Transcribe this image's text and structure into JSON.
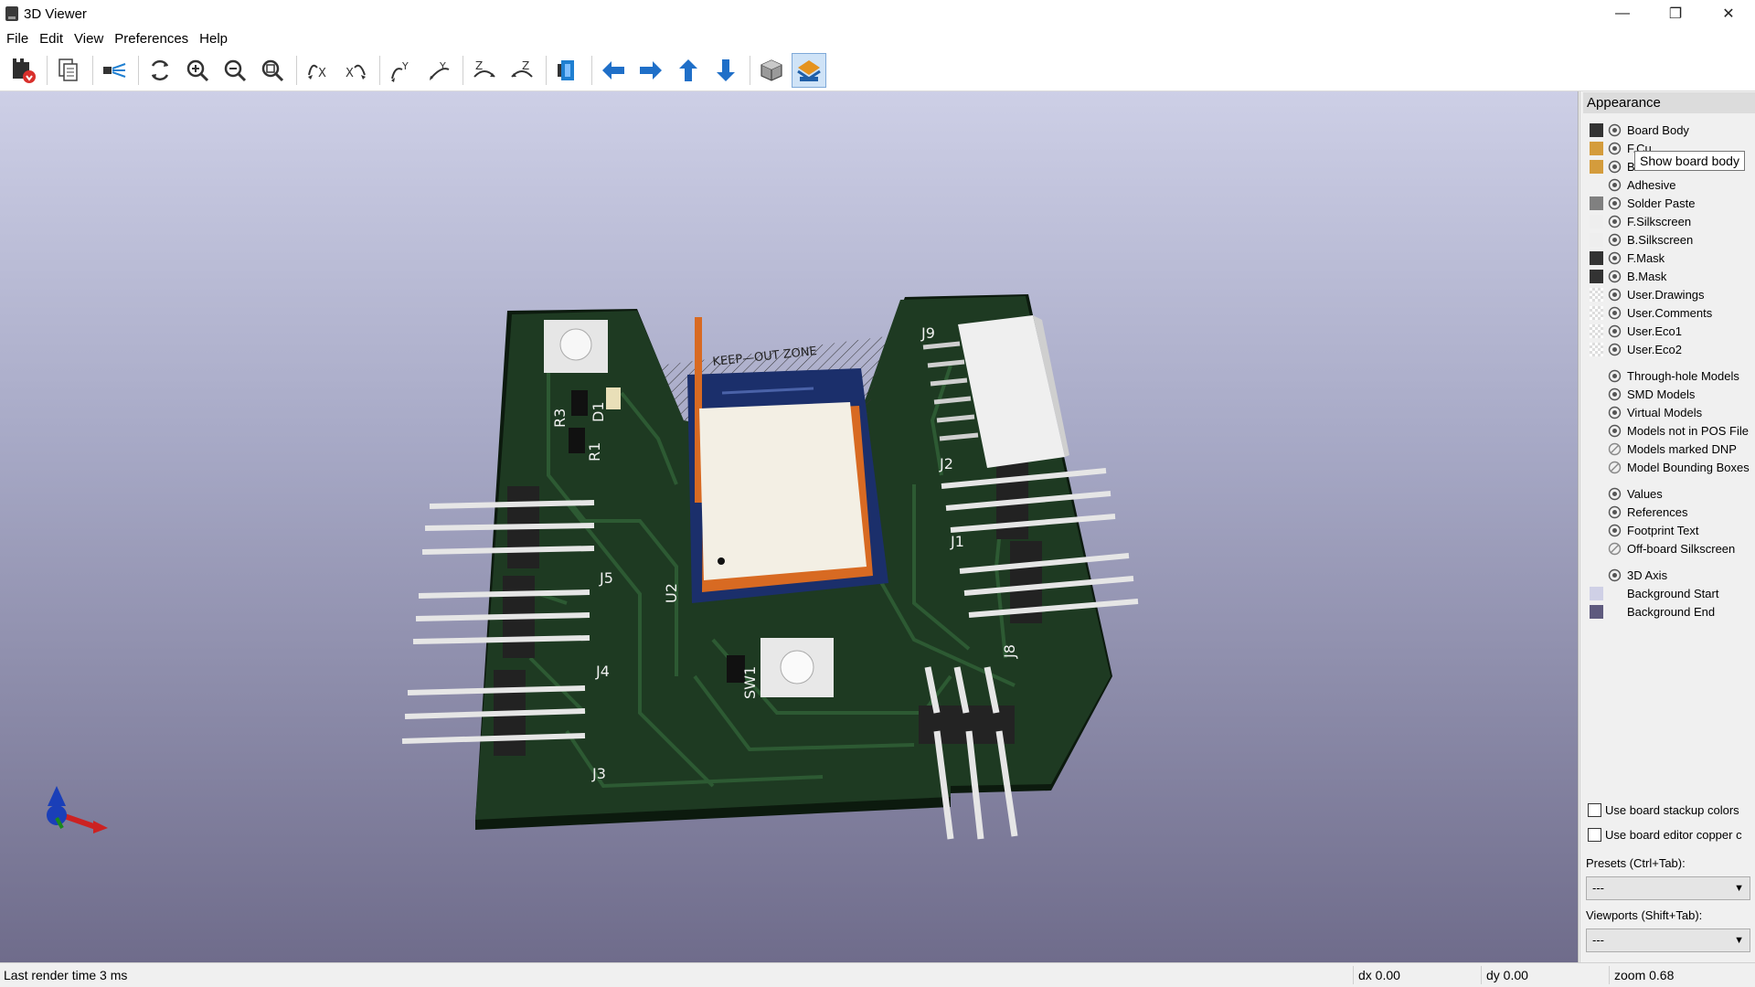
{
  "window": {
    "title": "3D Viewer",
    "controls": {
      "minimize": "—",
      "restore": "❐",
      "close": "✕"
    }
  },
  "menu": [
    "File",
    "Edit",
    "View",
    "Preferences",
    "Help"
  ],
  "toolbar": {
    "buttons": [
      "reload-board-icon",
      "copy-image-icon",
      "raytracing-icon",
      "redraw-icon",
      "zoom-in-icon",
      "zoom-out-icon",
      "zoom-fit-icon",
      "rotate-x-cw-icon",
      "rotate-x-ccw-icon",
      "rotate-y-cw-icon",
      "rotate-y-ccw-icon",
      "rotate-z-cw-icon",
      "rotate-z-ccw-icon",
      "flip-board-icon",
      "pan-left-icon",
      "pan-right-icon",
      "pan-up-icon",
      "pan-down-icon",
      "toggle-ortho-icon",
      "layers-manager-icon"
    ],
    "active": "layers-manager-icon"
  },
  "viewport": {
    "keepout_text": "KEEP—OUT ZONE",
    "refs": [
      "R3",
      "D1",
      "R1",
      "J5",
      "J4",
      "J3",
      "U2",
      "SW1",
      "J9",
      "J2",
      "J1",
      "J8"
    ]
  },
  "appearance": {
    "title": "Appearance",
    "layers": [
      {
        "name": "Board Body",
        "color": "#333333",
        "swatch": true
      },
      {
        "name": "F.Cu",
        "color": "#d49c3c",
        "swatch": true
      },
      {
        "name": "B.Cu",
        "color": "#d49c3c",
        "swatch": true
      },
      {
        "name": "Adhesive",
        "color": "",
        "swatch": false
      },
      {
        "name": "Solder Paste",
        "color": "#808080",
        "swatch": true
      },
      {
        "name": "F.Silkscreen",
        "color": "#eeeeee",
        "swatch": true
      },
      {
        "name": "B.Silkscreen",
        "color": "#eeeeee",
        "swatch": true
      },
      {
        "name": "F.Mask",
        "color": "#333333",
        "swatch": true
      },
      {
        "name": "B.Mask",
        "color": "#333333",
        "swatch": true
      },
      {
        "name": "User.Drawings",
        "color": "checker",
        "swatch": true
      },
      {
        "name": "User.Comments",
        "color": "checker",
        "swatch": true
      },
      {
        "name": "User.Eco1",
        "color": "checker",
        "swatch": true
      },
      {
        "name": "User.Eco2",
        "color": "checker",
        "swatch": true
      }
    ],
    "models": [
      {
        "name": "Through-hole Models",
        "visible": true
      },
      {
        "name": "SMD Models",
        "visible": true
      },
      {
        "name": "Virtual Models",
        "visible": true
      },
      {
        "name": "Models not in POS File",
        "visible": true
      },
      {
        "name": "Models marked DNP",
        "visible": false
      },
      {
        "name": "Model Bounding Boxes",
        "visible": false
      }
    ],
    "texts": [
      {
        "name": "Values",
        "visible": true
      },
      {
        "name": "References",
        "visible": true
      },
      {
        "name": "Footprint Text",
        "visible": true
      },
      {
        "name": "Off-board Silkscreen",
        "visible": false
      }
    ],
    "axis": "3D Axis",
    "background": [
      {
        "name": "Background Start",
        "color": "#cfd0e6"
      },
      {
        "name": "Background End",
        "color": "#5e5a7e"
      }
    ],
    "tooltip": "Show board body",
    "checkboxes": [
      "Use board stackup colors",
      "Use board editor copper c"
    ],
    "presets_label": "Presets (Ctrl+Tab):",
    "presets_value": "---",
    "viewports_label": "Viewports (Shift+Tab):",
    "viewports_value": "---"
  },
  "status": {
    "render": "Last render time 3 ms",
    "dx": "dx 0.00",
    "dy": "dy 0.00",
    "zoom": "zoom 0.68"
  }
}
